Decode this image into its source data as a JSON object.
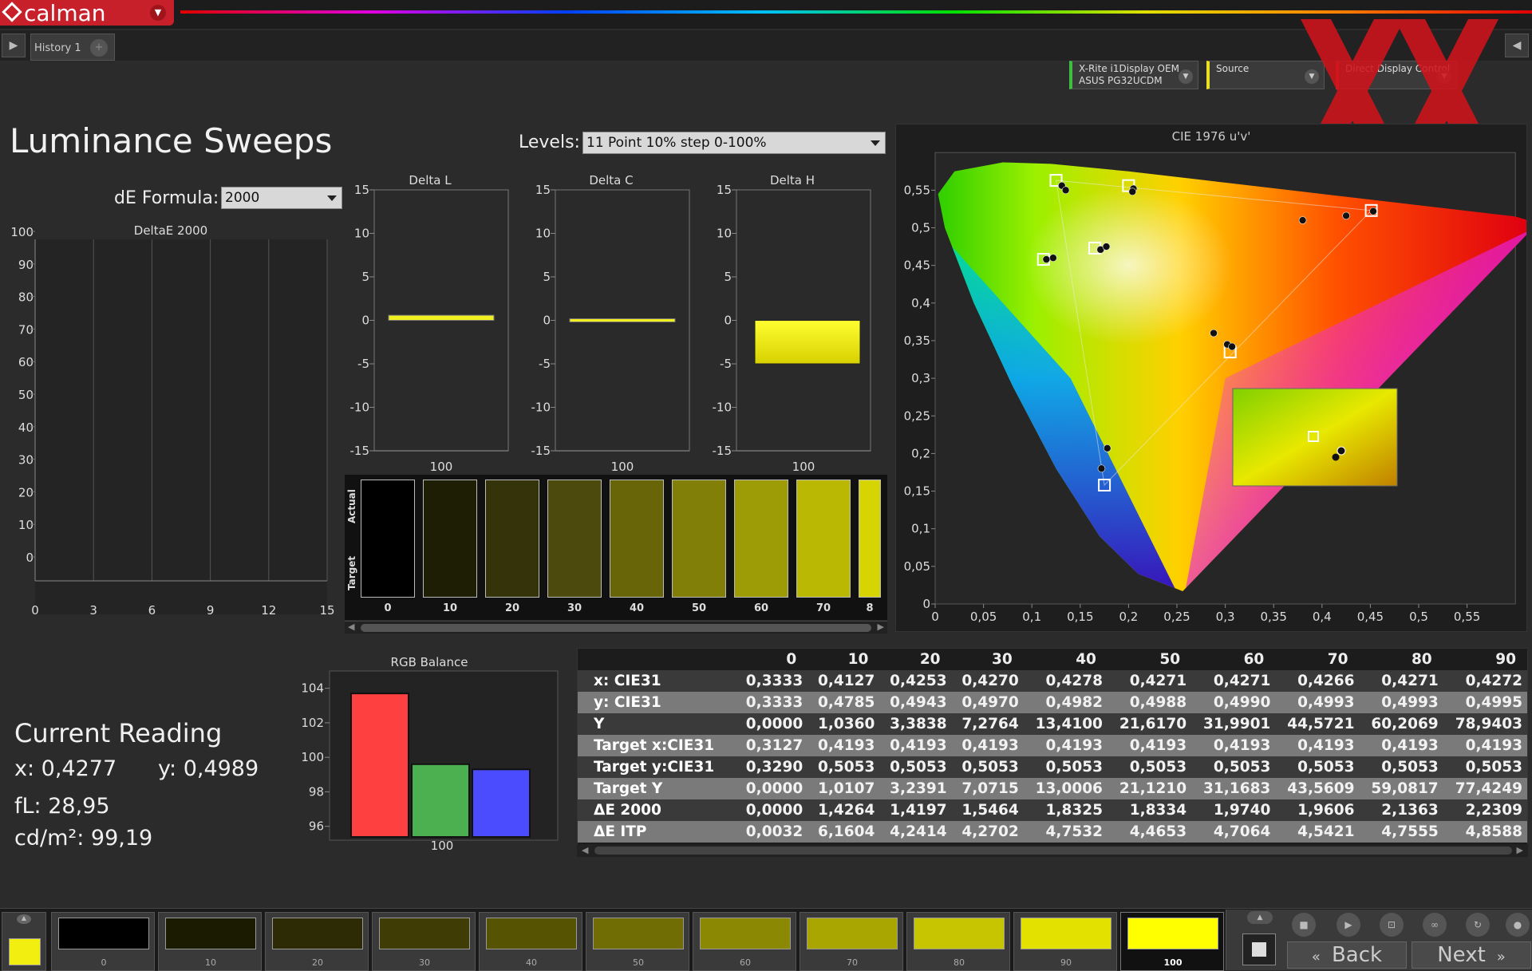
{
  "app": {
    "logo_text": "calman",
    "tab_name": "History 1",
    "add_tab": "+"
  },
  "devices": {
    "meter_line1": "X-Rite i1Display OEM",
    "meter_line2": "ASUS PG32UCDM",
    "source_label": "Source",
    "control_label": "Direct Display Control"
  },
  "page": {
    "title": "Luminance Sweeps",
    "de_formula_label": "dE Formula:",
    "de_formula_value": "2000",
    "levels_label": "Levels:",
    "levels_value": "11 Point 10% step 0-100%"
  },
  "deltaE_chart": {
    "title": "DeltaE 2000",
    "x_ticks": [
      "0",
      "3",
      "6",
      "9",
      "12",
      "15"
    ],
    "y_ticks": [
      "0",
      "10",
      "20",
      "30",
      "40",
      "50",
      "60",
      "70",
      "80",
      "90",
      "100"
    ]
  },
  "delta_charts": [
    {
      "title": "Delta L",
      "value": 0.4,
      "category": "100"
    },
    {
      "title": "Delta C",
      "value": 0.0,
      "category": "100"
    },
    {
      "title": "Delta H",
      "value": -5.0,
      "category": "100"
    }
  ],
  "delta_y_ticks": [
    "15",
    "10",
    "5",
    "0",
    "-5",
    "-10",
    "-15"
  ],
  "swatches": {
    "actual_label": "Actual",
    "target_label": "Target",
    "labels": [
      "0",
      "10",
      "20",
      "30",
      "40",
      "50",
      "60",
      "70",
      "8"
    ],
    "colors": [
      "#000000",
      "#1e1e04",
      "#34330a",
      "#4c4a0c",
      "#676508",
      "#817f08",
      "#9d9b06",
      "#bbb804",
      "#d6d402"
    ]
  },
  "cie": {
    "title": "CIE 1976 u'v'",
    "x_ticks": [
      "0",
      "0,05",
      "0,1",
      "0,15",
      "0,2",
      "0,25",
      "0,3",
      "0,35",
      "0,4",
      "0,45",
      "0,5",
      "0,55"
    ],
    "y_ticks": [
      "0",
      "0,05",
      "0,1",
      "0,15",
      "0,2",
      "0,25",
      "0,3",
      "0,35",
      "0,4",
      "0,45",
      "0,5",
      "0,55"
    ]
  },
  "rgb_balance": {
    "title": "RGB Balance",
    "y_ticks": [
      "104",
      "102",
      "100",
      "98",
      "96"
    ],
    "category": "100",
    "values": {
      "red": 103.7,
      "green": 99.6,
      "blue": 99.3
    },
    "colors": {
      "red": "#ff4040",
      "green": "#4caf50",
      "blue": "#4c4cff"
    }
  },
  "current_reading": {
    "title": "Current Reading",
    "x": "x: 0,4277",
    "y": "y: 0,4989",
    "fl": "fL: 28,95",
    "cdm2": "cd/m²: 99,19"
  },
  "table": {
    "columns": [
      "0",
      "10",
      "20",
      "30",
      "40",
      "50",
      "60",
      "70",
      "80",
      "90"
    ],
    "rows": [
      {
        "label": "x: CIE31",
        "values": [
          "0,3333",
          "0,4127",
          "0,4253",
          "0,4270",
          "0,4278",
          "0,4271",
          "0,4271",
          "0,4266",
          "0,4271",
          "0,4272"
        ]
      },
      {
        "label": "y: CIE31",
        "values": [
          "0,3333",
          "0,4785",
          "0,4943",
          "0,4970",
          "0,4982",
          "0,4988",
          "0,4990",
          "0,4993",
          "0,4993",
          "0,4995"
        ]
      },
      {
        "label": "Y",
        "values": [
          "0,0000",
          "1,0360",
          "3,3838",
          "7,2764",
          "13,4100",
          "21,6170",
          "31,9901",
          "44,5721",
          "60,2069",
          "78,9403"
        ]
      },
      {
        "label": "Target x:CIE31",
        "values": [
          "0,3127",
          "0,4193",
          "0,4193",
          "0,4193",
          "0,4193",
          "0,4193",
          "0,4193",
          "0,4193",
          "0,4193",
          "0,4193"
        ]
      },
      {
        "label": "Target y:CIE31",
        "values": [
          "0,3290",
          "0,5053",
          "0,5053",
          "0,5053",
          "0,5053",
          "0,5053",
          "0,5053",
          "0,5053",
          "0,5053",
          "0,5053"
        ]
      },
      {
        "label": "Target Y",
        "values": [
          "0,0000",
          "1,0107",
          "3,2391",
          "7,0715",
          "13,0006",
          "21,1210",
          "31,1683",
          "43,5609",
          "59,0817",
          "77,4249"
        ]
      },
      {
        "label": "ΔE 2000",
        "values": [
          "0,0000",
          "1,4264",
          "1,4197",
          "1,5464",
          "1,8325",
          "1,8334",
          "1,9740",
          "1,9606",
          "2,1363",
          "2,2309"
        ]
      },
      {
        "label": "ΔE ITP",
        "values": [
          "0,0032",
          "6,1604",
          "4,2414",
          "4,2702",
          "4,7532",
          "4,4653",
          "4,7064",
          "4,5421",
          "4,7555",
          "4,8588"
        ]
      }
    ]
  },
  "patches": {
    "labels": [
      "0",
      "10",
      "20",
      "30",
      "40",
      "50",
      "60",
      "70",
      "80",
      "90",
      "100"
    ],
    "colors": [
      "#000000",
      "#1b1b02",
      "#2c2b05",
      "#3f3d05",
      "#565403",
      "#6f6d03",
      "#8b8903",
      "#a9a602",
      "#c7c501",
      "#e3e100",
      "#ffff00"
    ],
    "current_color": "#f2ef10"
  },
  "nav": {
    "back_label": "Back",
    "next_label": "Next"
  }
}
